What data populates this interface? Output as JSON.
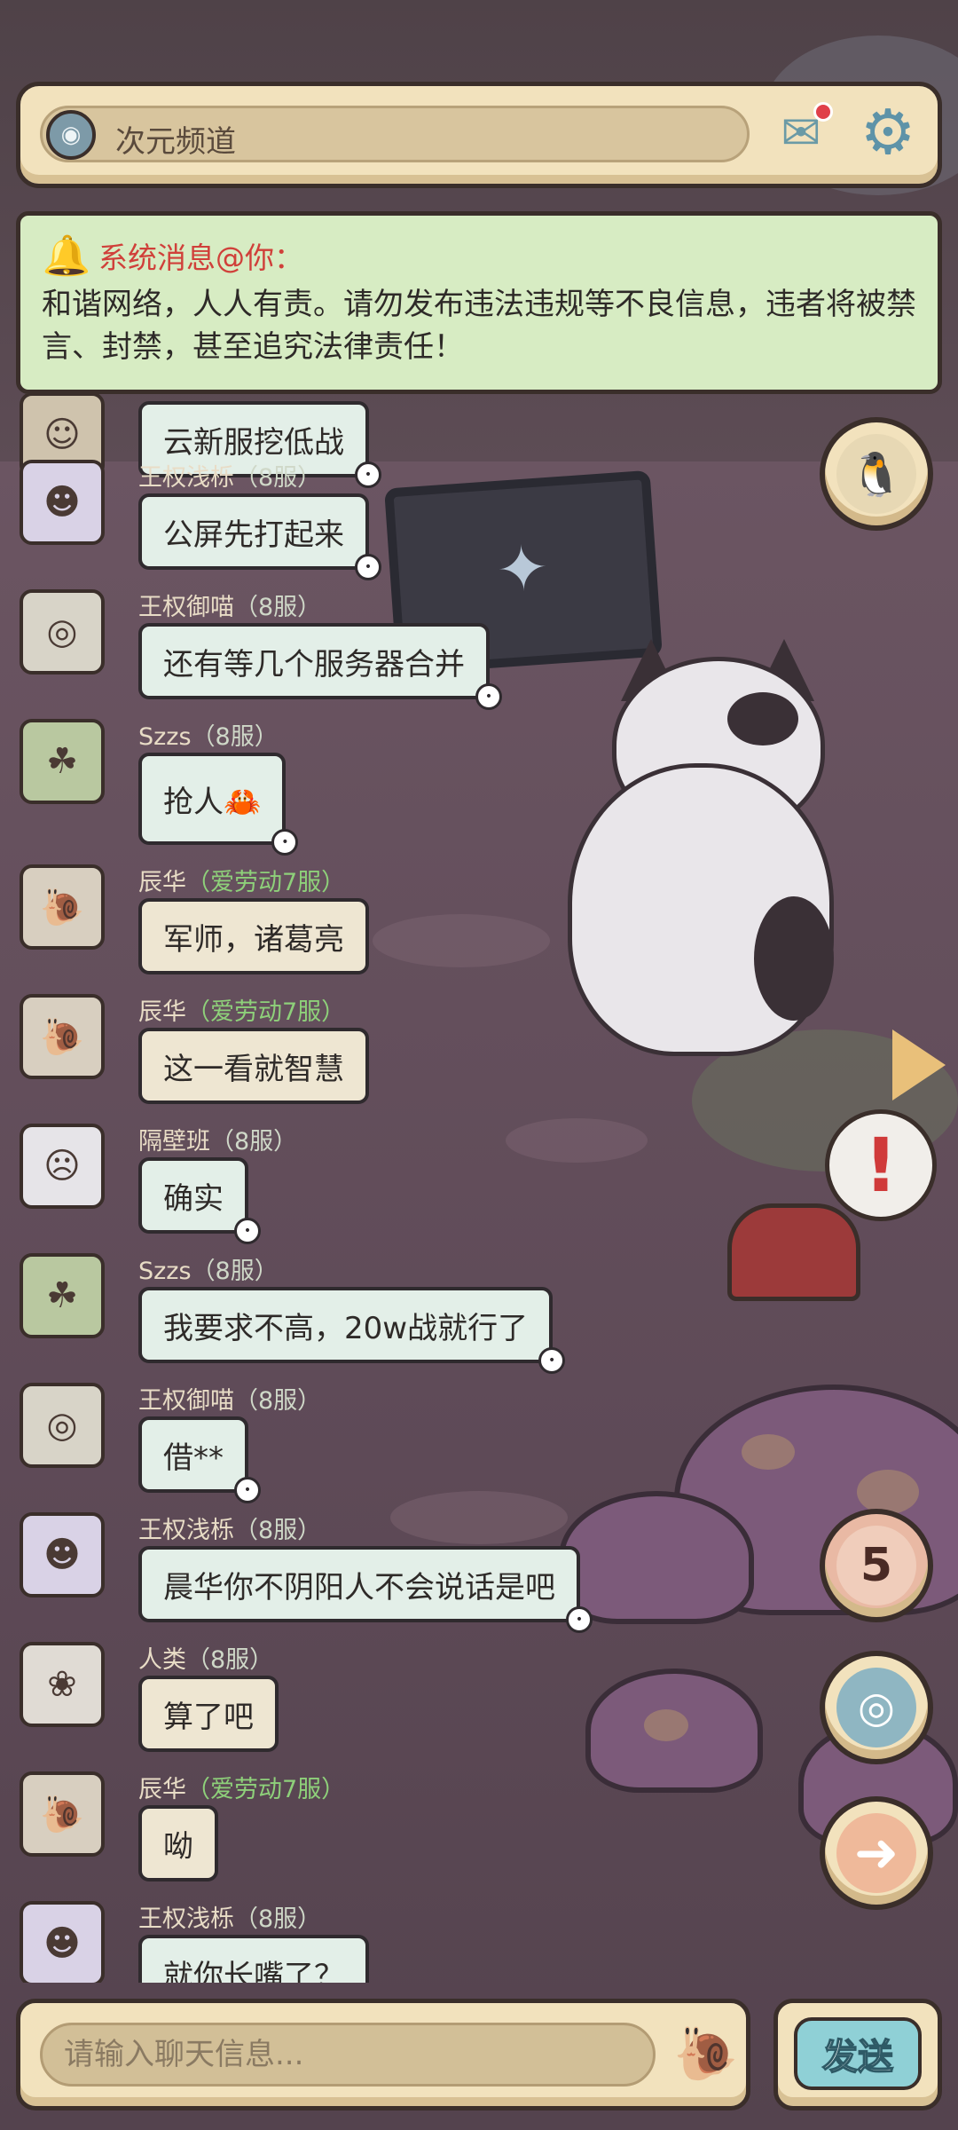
{
  "header": {
    "channel_name": "次元频道",
    "channel_icon": "channel-icon",
    "mail_icon": "mail-icon",
    "settings_icon": "gear-icon"
  },
  "system_message": {
    "title": "系统消息@你：",
    "body": "和谐网络，人人有责。请勿发布违法违规等不良信息，违者将被禁言、封禁，甚至追究法律责任！"
  },
  "messages": [
    {
      "sender": "",
      "server": "",
      "text": "云新服挖低战",
      "avatar": "avatar-goggles"
    },
    {
      "sender": "王权浅栎",
      "server": "（8服）",
      "text": "公屏先打起来",
      "avatar": "avatar-purple-mask"
    },
    {
      "sender": "王权御喵",
      "server": "（8服）",
      "text": "还有等几个服务器合并",
      "avatar": "avatar-spiral-glasses"
    },
    {
      "sender": "Szzs",
      "server": "（8服）",
      "text": "抢人🦀",
      "avatar": "avatar-green-frog"
    },
    {
      "sender": "辰华",
      "server": "（爱劳动7服）",
      "text": "军师，诸葛亮",
      "avatar": "avatar-snail"
    },
    {
      "sender": "辰华",
      "server": "（爱劳动7服）",
      "text": "这一看就智慧",
      "avatar": "avatar-snail"
    },
    {
      "sender": "隔壁班",
      "server": "（8服）",
      "text": "确实",
      "avatar": "avatar-pale-girl"
    },
    {
      "sender": "Szzs",
      "server": "（8服）",
      "text": "我要求不高，20w战就行了",
      "avatar": "avatar-green-frog"
    },
    {
      "sender": "王权御喵",
      "server": "（8服）",
      "text": "借**",
      "avatar": "avatar-spiral-glasses"
    },
    {
      "sender": "王权浅栎",
      "server": "（8服）",
      "text": "晨华你不阴阳人不会说话是吧",
      "avatar": "avatar-purple-mask"
    },
    {
      "sender": "人类",
      "server": "（8服）",
      "text": "算了吧",
      "avatar": "avatar-curly-hair"
    },
    {
      "sender": "辰华",
      "server": "（爱劳动7服）",
      "text": "呦",
      "avatar": "avatar-snail"
    },
    {
      "sender": "王权浅栎",
      "server": "（8服）",
      "text": "就你长嘴了？",
      "avatar": "avatar-purple-mask"
    }
  ],
  "side_buttons": {
    "qq_icon": "penguin-icon",
    "badge_count": "5",
    "ring_icon": "donut-icon",
    "arrow_icon": "arrow-right-icon"
  },
  "input": {
    "placeholder": "请输入聊天信息...",
    "emoji_icon": "snail-emoji-icon",
    "send_label": "发送"
  },
  "colors": {
    "panel": "#f2e2bd",
    "system_panel": "#d7ecc3",
    "system_title": "#d0403a",
    "bubble": "#e3efe8",
    "send_button": "#8fd0d6",
    "server_green": "#8ed07a"
  }
}
